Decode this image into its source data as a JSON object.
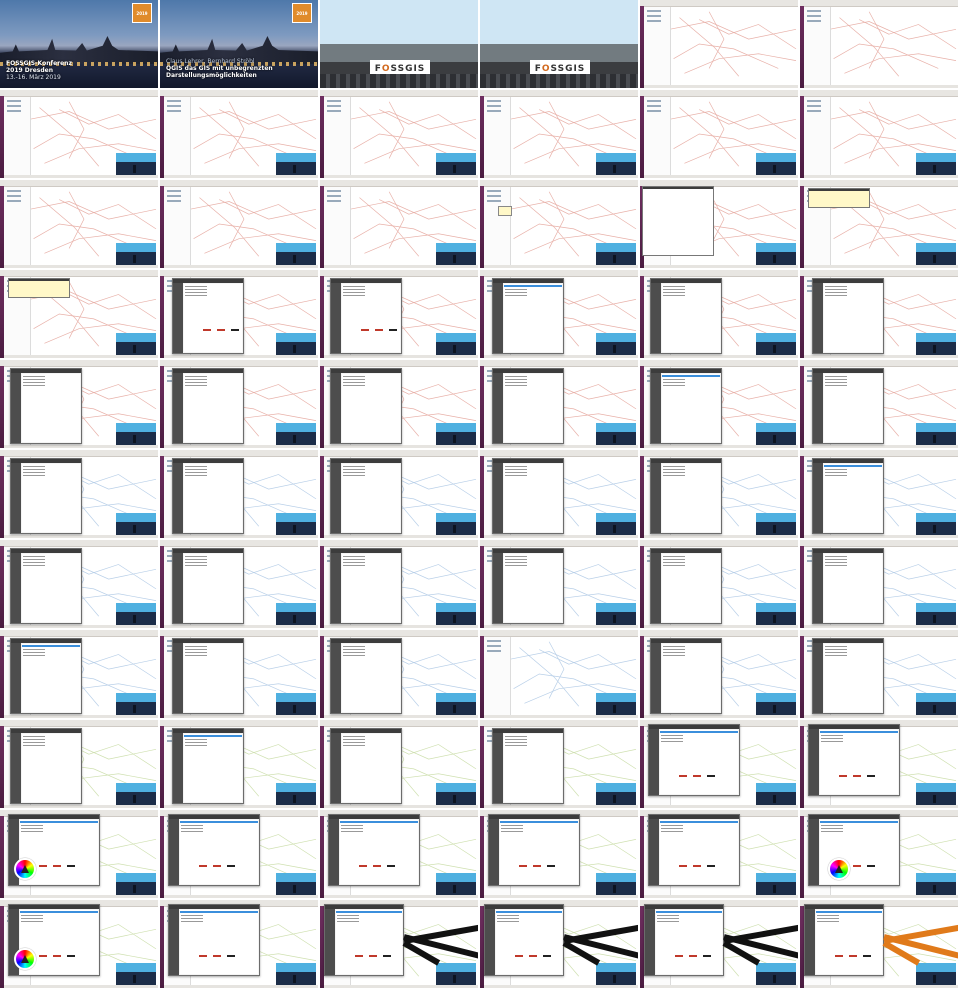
{
  "slide": {
    "logo_year": "2019",
    "logo_lines": [
      "G",
      "I",
      "FOSS"
    ],
    "conference": "FOSSGIS-Konferenz",
    "city": "2019 Dresden",
    "dates": "13.-16. März 2019",
    "speakers": "Claus Lehrer, Bernhard Ströbl",
    "talk_line1": "QGIS das GIS mit unbegrenzten",
    "talk_line2": "Darstellungsmöglichkeiten"
  },
  "stage": {
    "banner_prefix": "F",
    "banner_o": "O",
    "banner_suffix": "SSGIS"
  },
  "grid": {
    "columns": 6,
    "rows": 11
  },
  "colors": {
    "map_lines": "#e8b0a8",
    "map_lines_alt": "#b8cfe8",
    "map_lines_green": "#cfe0b0",
    "selection": "#3b8fdc",
    "style_orange": "#e07a1a",
    "style_red": "#c0392b"
  },
  "frames": [
    "title",
    "title_speakers",
    "stage",
    "stage",
    "map",
    "map",
    "map_video",
    "map_video",
    "map_video",
    "map_video",
    "map_video",
    "map_video",
    "map_video",
    "map_video",
    "map_video",
    "map_menu",
    "attr_table",
    "attr_table",
    "attr_table",
    "style_dialog",
    "style_dialog",
    "style_dialog",
    "style_dialog",
    "style_dialog",
    "style_dialog",
    "style_dialog",
    "style_dialog",
    "style_dialog",
    "style_dialog",
    "style_dialog",
    "style_dialog",
    "style_dialog",
    "style_dialog",
    "style_dialog",
    "style_dialog",
    "style_dialog_sel",
    "style_dialog",
    "style_dialog",
    "style_dialog",
    "style_dialog",
    "style_dialog",
    "style_dialog",
    "style_dialog",
    "style_dialog",
    "style_dialog",
    "map_blue",
    "style_dialog",
    "style_dialog",
    "style_dialog",
    "style_dialog",
    "style_dialog",
    "style_dialog",
    "symbol_dialog",
    "symbol_dialog",
    "symbol_color",
    "symbol_dialog",
    "symbol_dialog",
    "symbol_dialog",
    "symbol_dialog",
    "symbol_color",
    "symbol_color",
    "symbol_dialog",
    "thick_black",
    "thick_black",
    "thick_black",
    "thick_orange"
  ]
}
